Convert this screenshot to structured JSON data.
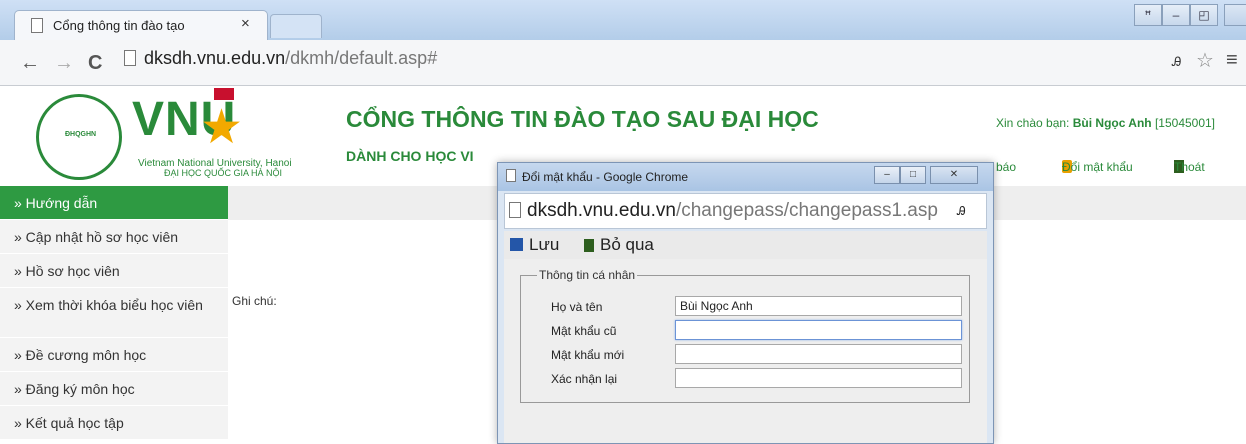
{
  "browser": {
    "tab_title": "Cổng thông tin đào tạo",
    "tab_close": "×",
    "url_host": "dksdh.vnu.edu.vn",
    "url_path": "/dkmh/default.asp#",
    "back": "←",
    "forward": "→",
    "reload": "C",
    "star": "☆",
    "menu": "≡",
    "translate": "Ꭿ",
    "window_controls": [
      "ꟸ",
      "–",
      "◰",
      "✕"
    ]
  },
  "header": {
    "logo_ring_text": "ĐHQGHN",
    "logo_text": "VNU",
    "logo_en": "Vietnam National University, Hanoi",
    "logo_vi": "ĐẠI HỌC QUỐC GIA HÀ NỘI",
    "title": "CỔNG THÔNG TIN ĐÀO TẠO SAU ĐẠI HỌC",
    "subtitle": "DÀNH CHO HỌC VI",
    "greeting_prefix": "Xin chào bạn: ",
    "greeting_name": "Bùi Ngọc Anh",
    "greeting_id": " [15045001]",
    "link_notify": "báo",
    "link_change_password": "Đổi mật khẩu",
    "link_logout": "Thoát"
  },
  "sidebar": {
    "items": [
      {
        "label": "» Hướng dẫn",
        "active": true
      },
      {
        "label": "» Cập nhật hồ sơ học viên"
      },
      {
        "label": "» Hồ sơ học viên"
      },
      {
        "label": "» Xem thời khóa biểu học viên"
      },
      {
        "label": "» Đề cương môn học"
      },
      {
        "label": "» Đăng ký môn học"
      },
      {
        "label": "» Kết quả học tập"
      }
    ]
  },
  "main": {
    "note_label": "Ghi chú:"
  },
  "popup": {
    "title": "Đổi mật khẩu - Google Chrome",
    "url_host": "dksdh.vnu.edu.vn",
    "url_path": "/changepass/changepass1.asp",
    "save_label": "Lưu",
    "skip_label": "Bỏ qua",
    "group_title": "Thông tin cá nhân",
    "fields": {
      "fullname_label": "Họ và tên",
      "fullname_value": "Bùi Ngọc Anh",
      "old_password_label": "Mật khẩu cũ",
      "new_password_label": "Mật khẩu mới",
      "confirm_label": "Xác nhận lại"
    },
    "window_controls": [
      "–",
      "□",
      "✕"
    ]
  },
  "colors": {
    "brand_green": "#2a8a3a",
    "active_menu": "#2e9a42"
  }
}
